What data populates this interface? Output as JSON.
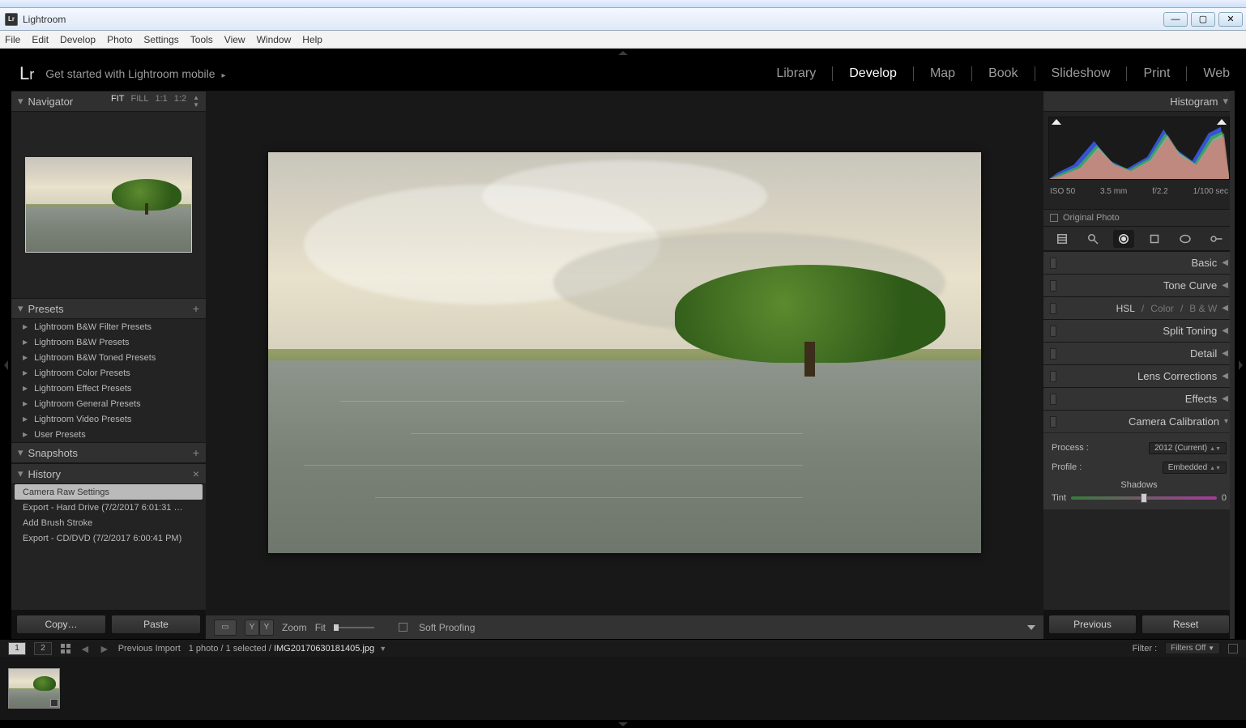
{
  "os": {
    "app_title": "Lightroom",
    "buttons": {
      "min": "—",
      "max": "▢",
      "close": "✕"
    }
  },
  "menubar": [
    "File",
    "Edit",
    "Develop",
    "Photo",
    "Settings",
    "Tools",
    "View",
    "Window",
    "Help"
  ],
  "identity": {
    "logo_l": "L",
    "logo_r": "r",
    "mobile": "Get started with Lightroom mobile",
    "mobile_arrow": "▸"
  },
  "modules": {
    "items": [
      "Library",
      "Develop",
      "Map",
      "Book",
      "Slideshow",
      "Print",
      "Web"
    ],
    "active": "Develop"
  },
  "left": {
    "navigator": {
      "title": "Navigator",
      "zoom": {
        "fit": "FIT",
        "fill": "FILL",
        "one": "1:1",
        "half": "1:2"
      }
    },
    "presets": {
      "title": "Presets",
      "items": [
        "Lightroom B&W Filter Presets",
        "Lightroom B&W Presets",
        "Lightroom B&W Toned Presets",
        "Lightroom Color Presets",
        "Lightroom Effect Presets",
        "Lightroom General Presets",
        "Lightroom Video Presets",
        "User Presets"
      ]
    },
    "snapshots": {
      "title": "Snapshots"
    },
    "history": {
      "title": "History",
      "items": [
        "Camera Raw Settings",
        "Export - Hard Drive (7/2/2017 6:01:31 …",
        "Add Brush Stroke",
        "Export - CD/DVD (7/2/2017 6:00:41 PM)"
      ],
      "selected_index": 0
    },
    "buttons": {
      "copy": "Copy…",
      "paste": "Paste"
    }
  },
  "toolbar": {
    "zoom_label": "Zoom",
    "fit_label": "Fit",
    "soft_proofing": "Soft Proofing",
    "view_single_label": "▭",
    "view_yy_label": "Y|Y"
  },
  "right": {
    "histogram": {
      "title": "Histogram",
      "exif": {
        "iso": "ISO 50",
        "focal": "3.5 mm",
        "aperture": "f/2.2",
        "shutter": "1/100 sec"
      },
      "original_photo": "Original Photo"
    },
    "sections": {
      "basic": "Basic",
      "tone_curve": "Tone Curve",
      "hsl": {
        "hsl": "HSL",
        "color": "Color",
        "bw": "B & W",
        "sep": "/"
      },
      "split_toning": "Split Toning",
      "detail": "Detail",
      "lens": "Lens Corrections",
      "effects": "Effects",
      "calibration": "Camera Calibration"
    },
    "calibration": {
      "process_label": "Process :",
      "process_value": "2012 (Current)",
      "profile_label": "Profile :",
      "profile_value": "Embedded",
      "shadows_label": "Shadows",
      "tint_label": "Tint",
      "tint_value": "0"
    },
    "buttons": {
      "previous": "Previous",
      "reset": "Reset"
    }
  },
  "stripbar": {
    "monitor1": "1",
    "monitor2": "2",
    "source": "Previous Import",
    "count": "1 photo / 1 selected /",
    "filename": "IMG20170630181405.jpg",
    "filter_label": "Filter :",
    "filter_value": "Filters Off"
  }
}
